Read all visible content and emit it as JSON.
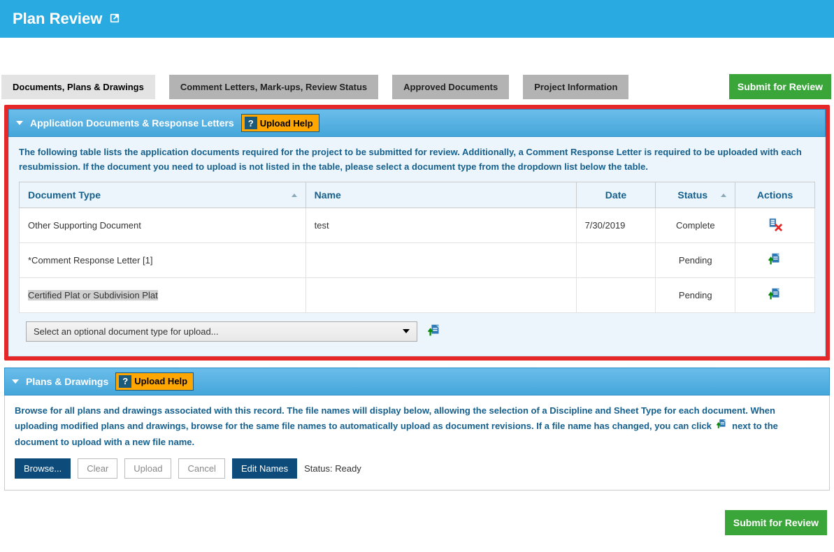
{
  "header": {
    "title": "Plan Review"
  },
  "tabs": {
    "items": [
      {
        "label": "Documents, Plans & Drawings"
      },
      {
        "label": "Comment Letters, Mark-ups, Review Status"
      },
      {
        "label": "Approved Documents"
      },
      {
        "label": "Project Information"
      }
    ],
    "submit_label": "Submit for Review"
  },
  "section_app": {
    "title": "Application Documents & Response Letters",
    "upload_help_label": "Upload Help",
    "intro": "The following table lists the application documents required for the project to be submitted for review. Additionally, a Comment Response Letter is required to be uploaded with each resubmission. If the document you need to upload is not listed in the table, please select a document type from the dropdown list below the table.",
    "columns": {
      "doc_type": "Document Type",
      "name": "Name",
      "date": "Date",
      "status": "Status",
      "actions": "Actions"
    },
    "rows": [
      {
        "doc_type": "Other Supporting Document",
        "name": "test",
        "date": "7/30/2019",
        "status": "Complete",
        "action": "delete"
      },
      {
        "doc_type": "*Comment Response Letter [1]",
        "name": "",
        "date": "",
        "status": "Pending",
        "action": "upload"
      },
      {
        "doc_type": "Certified Plat or Subdivision Plat",
        "name": "",
        "date": "",
        "status": "Pending",
        "action": "upload"
      }
    ],
    "optional_select_placeholder": "Select an optional document type for upload..."
  },
  "section_plans": {
    "title": "Plans & Drawings",
    "upload_help_label": "Upload Help",
    "intro_before": "Browse for all plans and drawings associated with this record. The file names will display below, allowing the selection of a Discipline and Sheet Type for each document. When uploading modified plans and drawings, browse for the same file names to automatically upload as document revisions. If a file name has changed, you can click ",
    "intro_after": " next to the document to upload with a new file name.",
    "buttons": {
      "browse": "Browse...",
      "clear": "Clear",
      "upload": "Upload",
      "cancel": "Cancel",
      "edit_names": "Edit Names"
    },
    "status_label": "Status: Ready"
  },
  "footer": {
    "submit_label": "Submit for Review"
  }
}
